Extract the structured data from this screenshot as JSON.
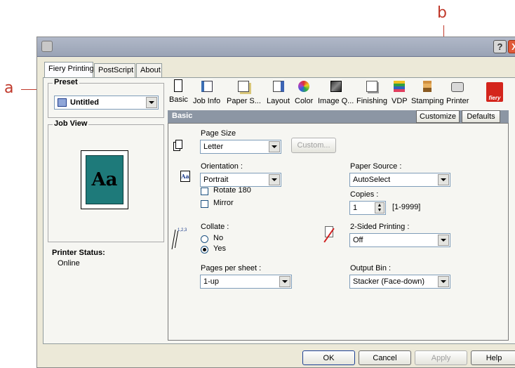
{
  "callouts": {
    "a": "a",
    "b": "b"
  },
  "window": {
    "help_btn": "?",
    "close_btn": "X",
    "tabs": [
      "Fiery Printing",
      "PostScript",
      "About"
    ]
  },
  "left": {
    "preset_label": "Preset",
    "preset_value": "Untitled",
    "jobview_label": "Job View",
    "jobview_sample": "Aa",
    "printer_status_label": "Printer Status:",
    "printer_status_value": "Online"
  },
  "toolbar": {
    "items": [
      "Basic",
      "Job Info",
      "Paper S...",
      "Layout",
      "Color",
      "Image Q...",
      "Finishing",
      "VDP",
      "Stamping",
      "Printer"
    ],
    "logo_text": "fiery"
  },
  "section": {
    "title": "Basic",
    "customize": "Customize",
    "defaults": "Defaults"
  },
  "form": {
    "page_size_label": "Page Size",
    "page_size_value": "Letter",
    "custom_btn": "Custom...",
    "orientation_label": "Orientation :",
    "orientation_value": "Portrait",
    "rotate_label": "Rotate 180",
    "mirror_label": "Mirror",
    "collate_label": "Collate :",
    "collate_no": "No",
    "collate_yes": "Yes",
    "collate_icon_text": "1,2,3",
    "pps_label": "Pages per sheet :",
    "pps_value": "1-up",
    "paper_source_label": "Paper Source :",
    "paper_source_value": "AutoSelect",
    "copies_label": "Copies :",
    "copies_value": "1",
    "copies_range": "[1-9999]",
    "two_sided_label": "2-Sided Printing :",
    "two_sided_value": "Off",
    "output_bin_label": "Output Bin :",
    "output_bin_value": "Stacker (Face-down)"
  },
  "footer": {
    "ok": "OK",
    "cancel": "Cancel",
    "apply": "Apply",
    "help": "Help"
  }
}
